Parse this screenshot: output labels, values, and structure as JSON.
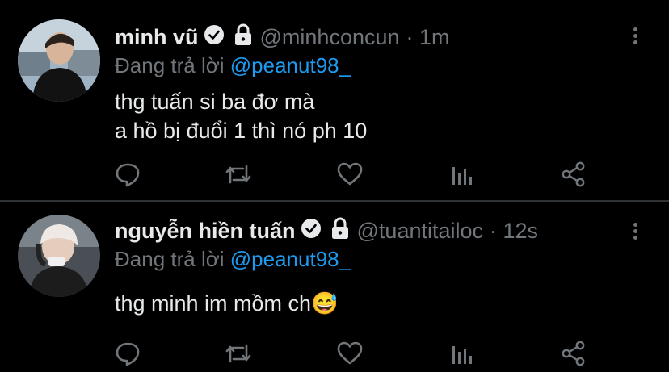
{
  "tweets": [
    {
      "name": "minh vũ",
      "handle": "@minhconcun",
      "time": "· 1m",
      "reply_prefix": "Đang trả lời ",
      "reply_to": "@peanut98_",
      "text_lines": [
        "thg tuấn si ba đơ mà",
        "a hồ bị đuổi 1 thì nó ph 10"
      ]
    },
    {
      "name": "nguyễn hiền tuấn",
      "handle": "@tuantitailoc",
      "time": "· 12s",
      "reply_prefix": "Đang trả lời ",
      "reply_to": "@peanut98_",
      "text_lines": [
        "thg minh im mồm ch😅"
      ]
    }
  ],
  "icons": [
    "verified-icon",
    "lock-icon",
    "more-icon",
    "reply-icon",
    "retweet-icon",
    "like-icon",
    "analytics-icon",
    "share-icon"
  ],
  "colors": {
    "background": "#000000",
    "text": "#e7e9ea",
    "secondary": "#71767b",
    "accent": "#1d9bf0"
  }
}
